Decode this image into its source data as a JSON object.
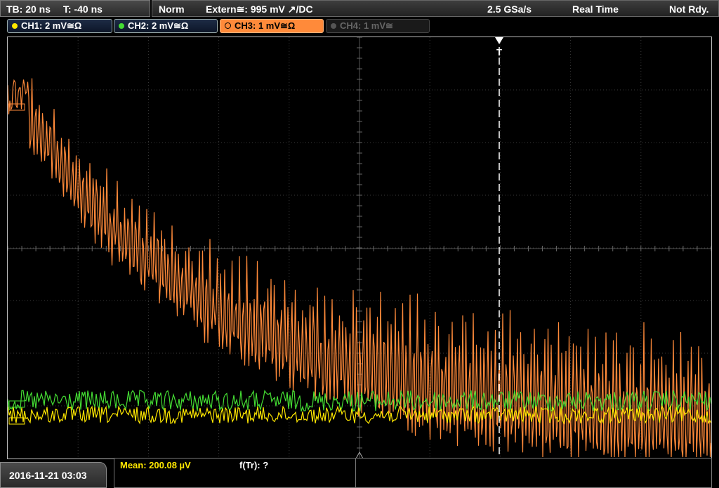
{
  "topbar": {
    "timebase": "TB: 20 ns",
    "trigger_time": "T: -40 ns",
    "trigger_mode": "Norm",
    "trigger_source": "Extern≅: 995 mV ↗/DC",
    "sample_rate": "2.5 GSa/s",
    "acq_mode": "Real Time",
    "status": "Not Rdy."
  },
  "channels": [
    {
      "label": "CH1: 2 mV≅Ω",
      "color": "#ffe800",
      "active": true
    },
    {
      "label": "CH2: 2 mV≅Ω",
      "color": "#44dd33",
      "active": true
    },
    {
      "label": "CH3: 1 mV≅Ω",
      "color": "#ff8a3a",
      "active": true,
      "selected": true
    },
    {
      "label": "CH4: 1 mV≅",
      "color": "#666666",
      "active": false
    }
  ],
  "colors": {
    "ch1": "#ffe800",
    "ch2": "#44dd33",
    "ch3": "#ff8a3a",
    "grid": "#3a3a3a",
    "trigger": "#ffffff"
  },
  "trigger_marker": "T",
  "measurement": {
    "mean": "Mean: 200.08 µV",
    "freq": "f(Tr): ?"
  },
  "timestamp": "2016-11-21 03:03",
  "icons": {
    "trigger_arrow": "down-triangle-icon",
    "ground_marker": "up-triangle-icon"
  }
}
